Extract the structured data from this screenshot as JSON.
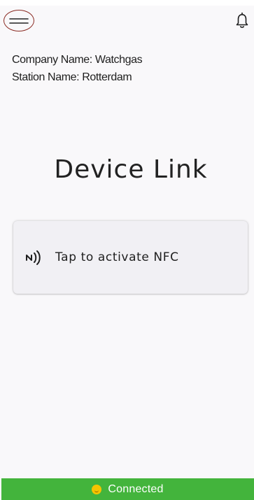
{
  "header": {
    "menu_icon": "hamburger-menu-icon",
    "notification_icon": "bell-icon",
    "accent_color": "#8a2a22"
  },
  "station_info": {
    "company": "Company Name: Watchgas",
    "station": "Station Name: Rotterdam"
  },
  "main": {
    "title": "Device Link",
    "nfc_card": {
      "icon": "nfc-icon",
      "label": "Tap to activate NFC"
    }
  },
  "status": {
    "text": "Connected",
    "icon": "smiley-icon",
    "background_color": "#43b43c"
  }
}
